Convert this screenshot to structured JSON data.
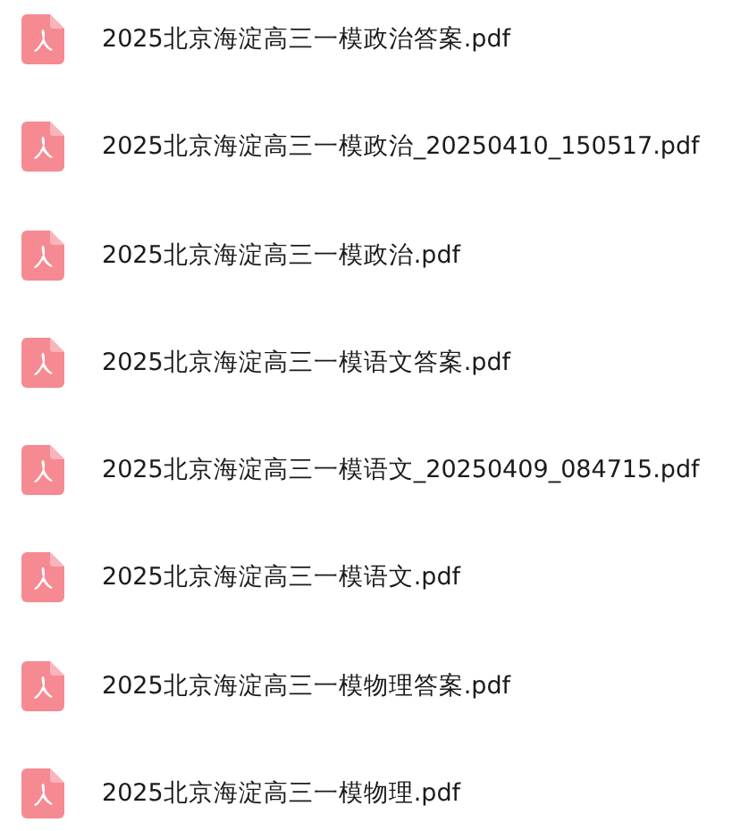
{
  "files": [
    {
      "name": "2025北京海淀高三一模政治答案.pdf"
    },
    {
      "name": "2025北京海淀高三一模政治_20250410_150517.pdf"
    },
    {
      "name": "2025北京海淀高三一模政治.pdf"
    },
    {
      "name": "2025北京海淀高三一模语文答案.pdf"
    },
    {
      "name": "2025北京海淀高三一模语文_20250409_084715.pdf"
    },
    {
      "name": "2025北京海淀高三一模语文.pdf"
    },
    {
      "name": "2025北京海淀高三一模物理答案.pdf"
    },
    {
      "name": "2025北京海淀高三一模物理.pdf"
    }
  ]
}
